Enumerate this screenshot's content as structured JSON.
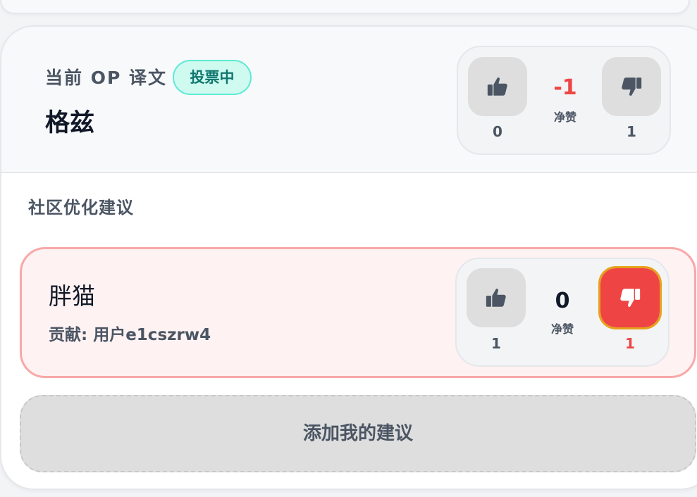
{
  "current_op": {
    "label": "当前 OP 译文",
    "status_badge": "投票中",
    "text": "格兹",
    "votes": {
      "up_count": "0",
      "down_count": "1",
      "net_value": "-1",
      "net_label": "净赞",
      "up_icon": "thumbs-up-icon",
      "down_icon": "thumbs-down-icon"
    }
  },
  "community": {
    "title": "社区优化建议",
    "suggestions": [
      {
        "text": "胖猫",
        "contributor": "贡献: 用户e1cszrw4",
        "votes": {
          "up_count": "1",
          "down_count": "1",
          "net_value": "0",
          "net_label": "净赞",
          "down_selected": true
        }
      }
    ],
    "add_button": "添加我的建议"
  },
  "colors": {
    "accent_red": "#ef4444",
    "badge_teal": "#0f766e",
    "badge_bg": "#cffaf0",
    "focus_outline": "#e6a21b"
  }
}
